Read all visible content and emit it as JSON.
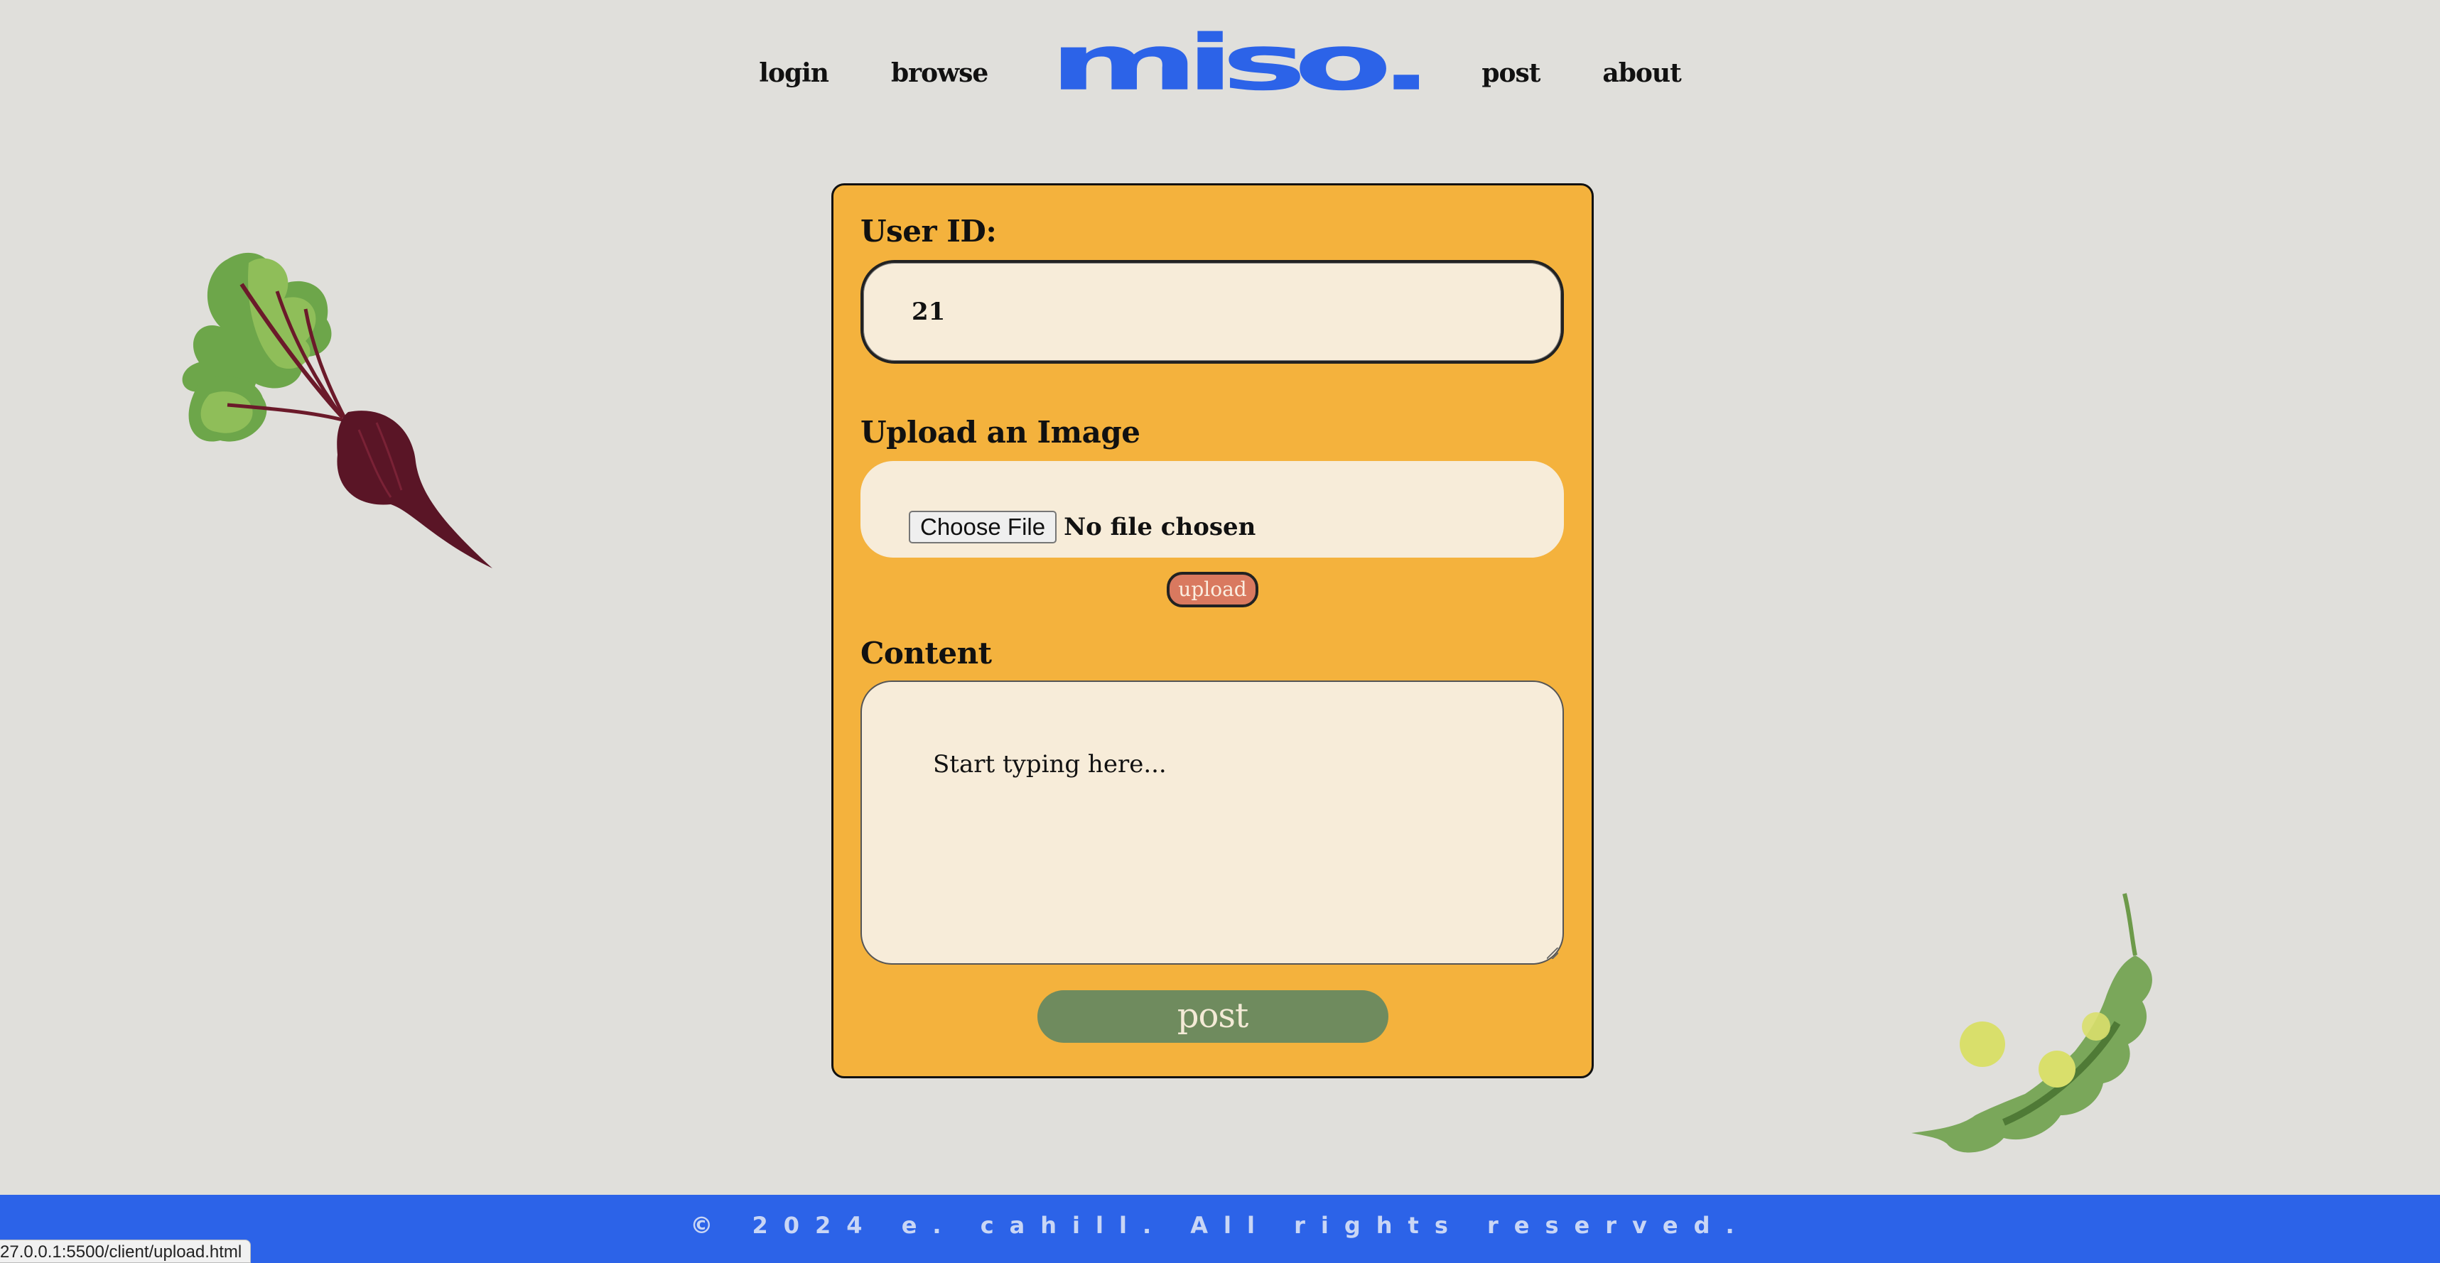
{
  "nav": {
    "links": [
      "login",
      "browse",
      "post",
      "about"
    ],
    "logo": "miso."
  },
  "form": {
    "user_id_label": "User ID:",
    "user_id_value": "21",
    "upload_label": "Upload an Image",
    "choose_file_label": "Choose File",
    "no_file_text": "No file chosen",
    "upload_button": "upload",
    "content_label": "Content",
    "content_placeholder": "Start typing here...",
    "post_button": "post"
  },
  "footer": {
    "text": "© 2024 e. cahill. All rights reserved."
  },
  "statusbar": {
    "url": "27.0.0.1:5500/client/upload.html"
  },
  "decorations": {
    "left": "beet-illustration",
    "right": "pea-pod-illustration"
  },
  "colors": {
    "background": "#e0dfdb",
    "brand_blue": "#2c63e8",
    "card": "#f4b23d",
    "field": "#f7ecd9",
    "upload_button": "#d9795f",
    "post_button": "#6f8b5e"
  }
}
